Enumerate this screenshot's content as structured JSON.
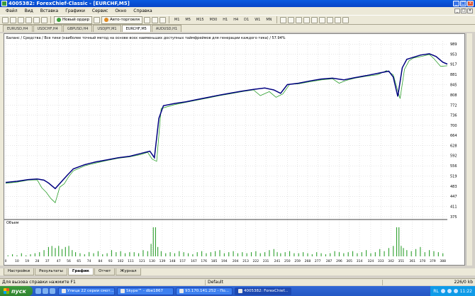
{
  "window": {
    "title": "4005382: ForexChief-Classic - [EURCHF,M5]",
    "buttons": [
      "_",
      "□",
      "×"
    ]
  },
  "menu": [
    "Файл",
    "Вид",
    "Вставка",
    "Графики",
    "Сервис",
    "Окно",
    "Справка"
  ],
  "mdi_buttons": [
    "_",
    "□",
    "×"
  ],
  "toolbar": {
    "new_order": "Новый ордер",
    "autotrading": "Авто-торговля",
    "timeframes": [
      "M1",
      "M5",
      "M15",
      "M30",
      "H1",
      "H4",
      "D1",
      "W1",
      "MN"
    ]
  },
  "symbol_tabs": [
    {
      "label": "EURUSD,H4",
      "active": false
    },
    {
      "label": "USDCHF,H4",
      "active": false
    },
    {
      "label": "GBPUSD,H4",
      "active": false
    },
    {
      "label": "USDJPY,M1",
      "active": false
    },
    {
      "label": "EURCHF,M5",
      "active": true
    },
    {
      "label": "AUDUSD,H1",
      "active": false
    }
  ],
  "chart": {
    "header_text": "Баланс / Средства / Все тики (наиболее точный метод на основе всех наименьших доступных таймфреймов для генерации каждого тика) / 57.94%",
    "volume_label": "Объем",
    "colors": {
      "balance": "#000080",
      "equity": "#2ea02e",
      "volume": "#2ea02e",
      "grid": "#c0c0c0"
    }
  },
  "chart_data": {
    "type": "line",
    "ylim": [
      375,
      1000
    ],
    "y_ticks": [
      989,
      953,
      917,
      881,
      845,
      808,
      772,
      736,
      700,
      664,
      628,
      592,
      556,
      519,
      483,
      447,
      411,
      375
    ],
    "x_ticks": [
      "0",
      "10",
      "19",
      "28",
      "37",
      "47",
      "56",
      "65",
      "74",
      "84",
      "93",
      "102",
      "111",
      "121",
      "130",
      "139",
      "148",
      "157",
      "167",
      "176",
      "185",
      "194",
      "204",
      "213",
      "222",
      "231",
      "241",
      "250",
      "259",
      "268",
      "277",
      "287",
      "296",
      "305",
      "314",
      "324",
      "333",
      "342",
      "351",
      "361",
      "370",
      "379",
      "388"
    ],
    "series": [
      {
        "name": "Баланс",
        "x": [
          0,
          10,
          20,
          28,
          34,
          38,
          44,
          50,
          55,
          60,
          70,
          80,
          90,
          100,
          110,
          120,
          128,
          132,
          136,
          140,
          150,
          160,
          170,
          180,
          190,
          200,
          210,
          220,
          230,
          238,
          244,
          250,
          260,
          270,
          280,
          290,
          300,
          310,
          320,
          330,
          340,
          344,
          348,
          352,
          356,
          360,
          368,
          376,
          382,
          388,
          392
        ],
        "values": [
          497,
          501,
          507,
          509,
          505,
          495,
          475,
          502,
          524,
          545,
          560,
          570,
          577,
          585,
          590,
          600,
          608,
          585,
          725,
          770,
          778,
          784,
          792,
          800,
          808,
          815,
          822,
          828,
          833,
          826,
          814,
          845,
          850,
          858,
          865,
          868,
          862,
          870,
          877,
          885,
          893,
          872,
          803,
          905,
          935,
          940,
          950,
          955,
          945,
          925,
          918
        ]
      },
      {
        "name": "Средства",
        "x": [
          0,
          10,
          20,
          28,
          32,
          36,
          40,
          44,
          48,
          52,
          56,
          60,
          70,
          80,
          90,
          100,
          110,
          120,
          126,
          130,
          134,
          138,
          150,
          160,
          170,
          180,
          190,
          200,
          210,
          220,
          226,
          234,
          240,
          246,
          252,
          260,
          270,
          280,
          290,
          296,
          302,
          310,
          320,
          330,
          338,
          344,
          350,
          354,
          358,
          362,
          370,
          376,
          380,
          386,
          392
        ],
        "values": [
          494,
          498,
          505,
          506,
          478,
          462,
          440,
          425,
          480,
          492,
          518,
          538,
          556,
          566,
          575,
          583,
          588,
          596,
          604,
          580,
          572,
          760,
          774,
          782,
          790,
          798,
          806,
          813,
          820,
          826,
          806,
          820,
          800,
          812,
          846,
          848,
          855,
          862,
          866,
          850,
          860,
          868,
          875,
          880,
          895,
          880,
          795,
          900,
          930,
          940,
          946,
          952,
          938,
          910,
          912
        ]
      }
    ],
    "volume_bars": {
      "x": [
        2,
        6,
        10,
        14,
        18,
        22,
        26,
        30,
        34,
        38,
        41,
        44,
        47,
        50,
        53,
        56,
        59,
        62,
        66,
        70,
        74,
        78,
        82,
        86,
        90,
        94,
        98,
        102,
        106,
        110,
        114,
        118,
        122,
        126,
        129,
        131,
        133,
        135,
        138,
        142,
        146,
        150,
        154,
        158,
        162,
        166,
        170,
        174,
        178,
        182,
        186,
        190,
        194,
        198,
        202,
        206,
        210,
        214,
        218,
        222,
        226,
        230,
        234,
        238,
        241,
        244,
        248,
        252,
        256,
        260,
        264,
        268,
        272,
        276,
        280,
        284,
        288,
        292,
        296,
        300,
        304,
        308,
        312,
        316,
        320,
        324,
        328,
        332,
        336,
        340,
        344,
        347,
        349,
        351,
        353,
        356,
        360,
        364,
        368,
        372,
        376,
        380,
        384,
        388
      ],
      "values": [
        1,
        2,
        1,
        3,
        1,
        2,
        3,
        4,
        6,
        9,
        10,
        8,
        10,
        7,
        9,
        10,
        6,
        4,
        3,
        2,
        4,
        3,
        5,
        2,
        3,
        6,
        4,
        5,
        3,
        4,
        4,
        3,
        6,
        5,
        12,
        28,
        28,
        9,
        5,
        3,
        4,
        3,
        5,
        4,
        3,
        2,
        4,
        5,
        3,
        4,
        5,
        6,
        3,
        4,
        5,
        3,
        4,
        3,
        4,
        5,
        3,
        4,
        6,
        7,
        4,
        3,
        4,
        5,
        3,
        3,
        4,
        3,
        2,
        4,
        3,
        2,
        3,
        5,
        4,
        3,
        4,
        5,
        3,
        4,
        6,
        3,
        4,
        7,
        5,
        8,
        10,
        28,
        28,
        10,
        8,
        6,
        5,
        7,
        9,
        4,
        6,
        5,
        4,
        3
      ],
      "ymax": 30
    }
  },
  "bottom_tabs": [
    {
      "label": "Настройки",
      "active": false
    },
    {
      "label": "Результаты",
      "active": false
    },
    {
      "label": "График",
      "active": true
    },
    {
      "label": "Отчет",
      "active": false
    },
    {
      "label": "Журнал",
      "active": false
    }
  ],
  "statusbar": {
    "help": "Для вызова справки нажмите F1",
    "profile": "Default",
    "traffic": "226/0 kb"
  },
  "taskbar": {
    "start": "пуск",
    "tasks": [
      {
        "label": "Улица 22 серии смот...",
        "active": false
      },
      {
        "label": "Skype™ - dbe1867",
        "active": false
      },
      {
        "label": "93.170.141.252 - По...",
        "active": false
      },
      {
        "label": "4005382: ForexChief...",
        "active": true
      }
    ],
    "tray_lang": "RL",
    "clock": "11:22"
  }
}
